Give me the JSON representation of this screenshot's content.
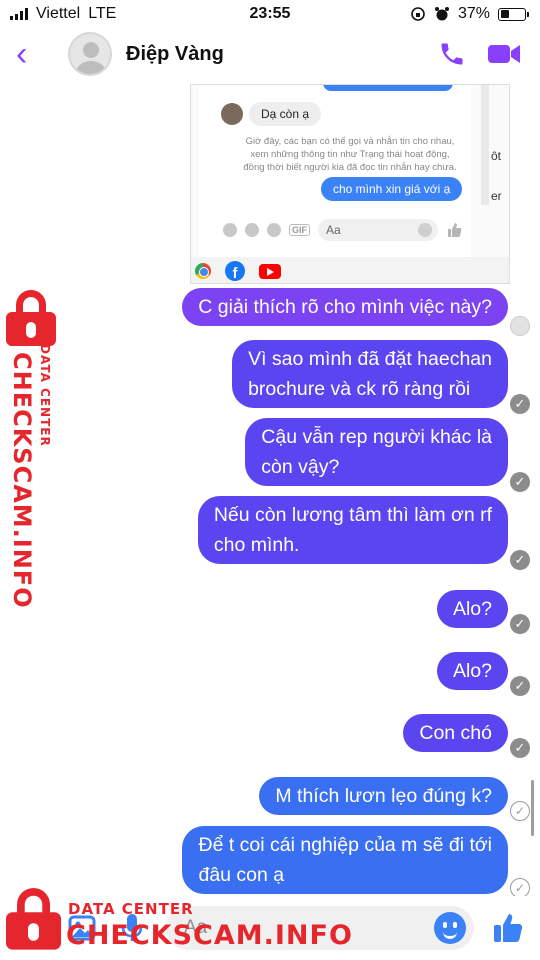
{
  "status_bar": {
    "carrier": "Viettel",
    "network": "LTE",
    "time": "23:55",
    "battery": "37%",
    "battery_level": 0.37
  },
  "header": {
    "contact_name": "Điệp Vàng",
    "icons": [
      "back-chevron-icon",
      "phone-icon",
      "video-camera-icon"
    ],
    "accent_color": "#8a3ffc"
  },
  "embedded_screenshot": {
    "received_message": "Dạ còn ạ",
    "info_text": [
      "Giờ đây, các bạn có thể gọi và nhắn tin cho nhau,",
      "xem những thông tin như Trạng thái hoạt động,",
      "đồng thời biết người kia đã đọc tin nhắn hay chưa."
    ],
    "sent_message": "cho mình xin giá với ạ",
    "input_placeholder": "Aa",
    "gif_label": "GIF",
    "side_fragments": [
      "ôt",
      "er"
    ]
  },
  "messages": [
    {
      "text": "C giải thích rõ cho mình việc này?",
      "receipt": "avatar"
    },
    {
      "text_lines": [
        "Vì sao mình đã đặt haechan",
        "brochure và ck rõ ràng rồi"
      ],
      "receipt": "delivered"
    },
    {
      "text_lines": [
        "Cậu vẫn rep người khác là",
        "còn vậy?"
      ],
      "receipt": "delivered"
    },
    {
      "text_lines": [
        "Nếu còn lương tâm thì làm ơn rf",
        "cho mình."
      ],
      "receipt": "delivered"
    },
    {
      "text": "Alo?",
      "receipt": "delivered"
    },
    {
      "text": "Alo?",
      "receipt": "delivered"
    },
    {
      "text": "Con chó",
      "receipt": "delivered"
    },
    {
      "text": "M thích lươn lẹo đúng k?",
      "receipt": "sent"
    },
    {
      "text_lines": [
        "Để t coi cái nghiệp của m sẽ đi tới",
        "đâu con ạ"
      ],
      "receipt": "sent"
    }
  ],
  "composer": {
    "placeholder": "Aa",
    "icons": [
      "camera-icon",
      "photo-icon",
      "microphone-icon",
      "emoji-icon",
      "thumbs-up-icon"
    ]
  },
  "watermark": {
    "brand": "CHECKSCAM.INFO",
    "subtitle": "DATA CENTER",
    "color": "#e5262d"
  }
}
